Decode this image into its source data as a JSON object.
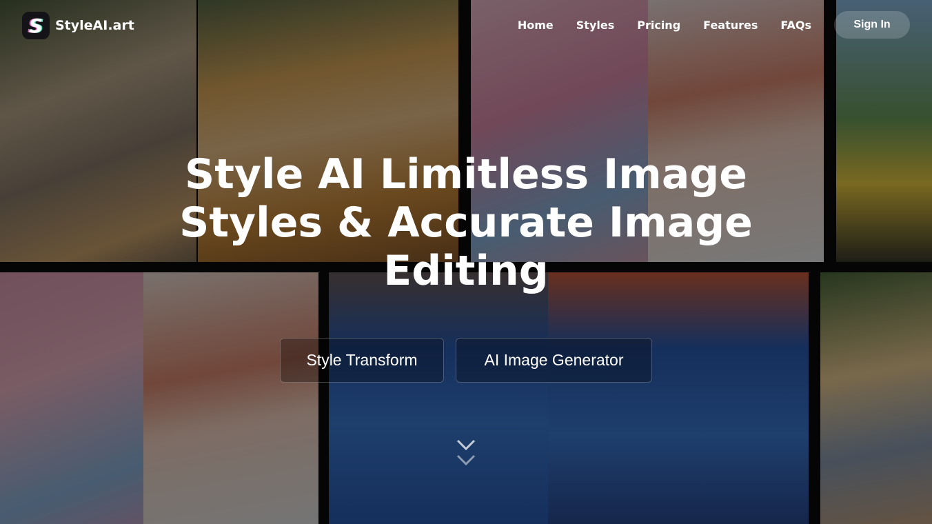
{
  "brand": {
    "name": "StyleAI.art",
    "logo_letter": "S"
  },
  "nav": {
    "items": [
      "Home",
      "Styles",
      "Pricing",
      "Features",
      "FAQs"
    ],
    "sign_in": "Sign In"
  },
  "hero": {
    "title": "Style AI Limitless Image Styles & Accurate Image Editing",
    "buttons": [
      "Style Transform",
      "AI Image Generator"
    ]
  }
}
